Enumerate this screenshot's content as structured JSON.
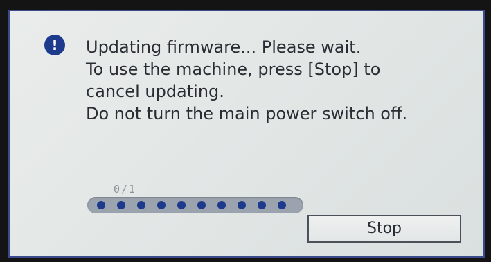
{
  "dialog": {
    "icon": "info-icon",
    "icon_glyph": "!",
    "message_lines": [
      "Updating firmware... Please wait.",
      "To use the machine, press [Stop] to",
      "cancel updating.",
      "Do not turn the main power switch off."
    ]
  },
  "progress": {
    "count_text": "0/1",
    "completed": 0,
    "total": 1,
    "fraction": 0
  },
  "buttons": {
    "stop_label": "Stop"
  },
  "colors": {
    "accent": "#1e3a8c",
    "screen_bg": "#e6eae9",
    "text": "#2a2c33"
  }
}
